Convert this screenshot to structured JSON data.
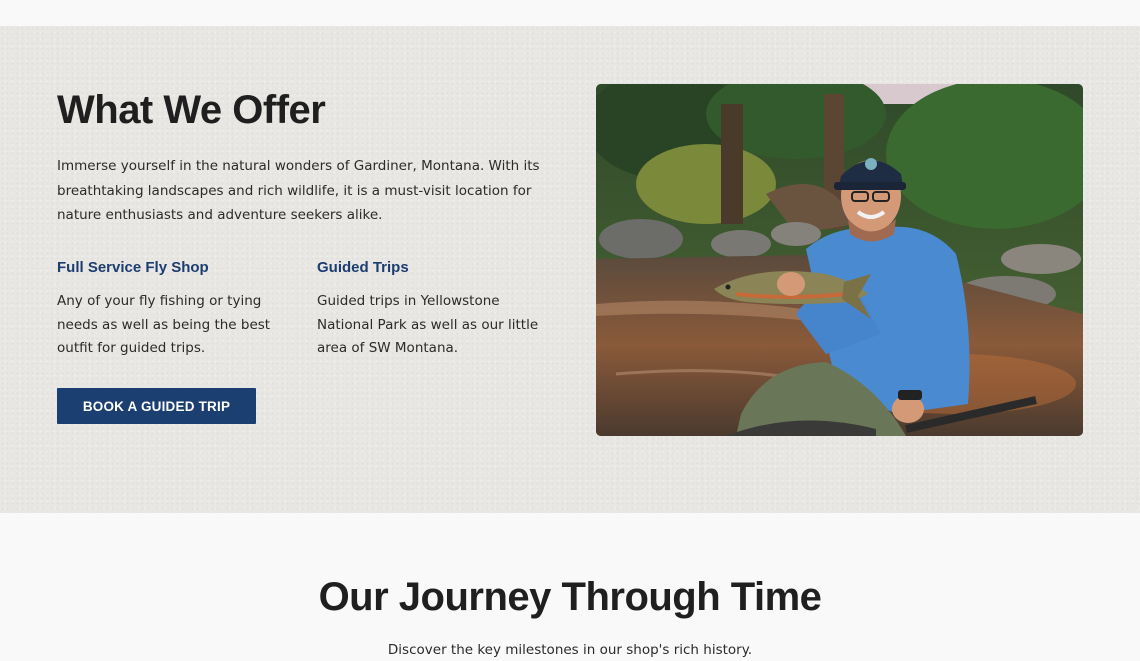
{
  "offer": {
    "title": "What We Offer",
    "intro": "Immerse yourself in the natural wonders of Gardiner, Montana. With its breathtaking landscapes and rich wildlife, it is a must-visit location for nature enthusiasts and adventure seekers alike.",
    "features": [
      {
        "heading": "Full Service Fly Shop",
        "text": "Any of your fly fishing or tying needs as well as being the best outfit for guided trips."
      },
      {
        "heading": "Guided Trips",
        "text": "Guided trips in Yellowstone National Park as well as our little area of SW Montana."
      }
    ],
    "button_label": "Book a Guided Trip",
    "colors": {
      "accent": "#1c3f72",
      "heading_blue": "#1c3d70",
      "section_bg": "#e9e7e3"
    }
  },
  "journey": {
    "title": "Our Journey Through Time",
    "subtitle": "Discover the key milestones in our shop's rich history."
  }
}
